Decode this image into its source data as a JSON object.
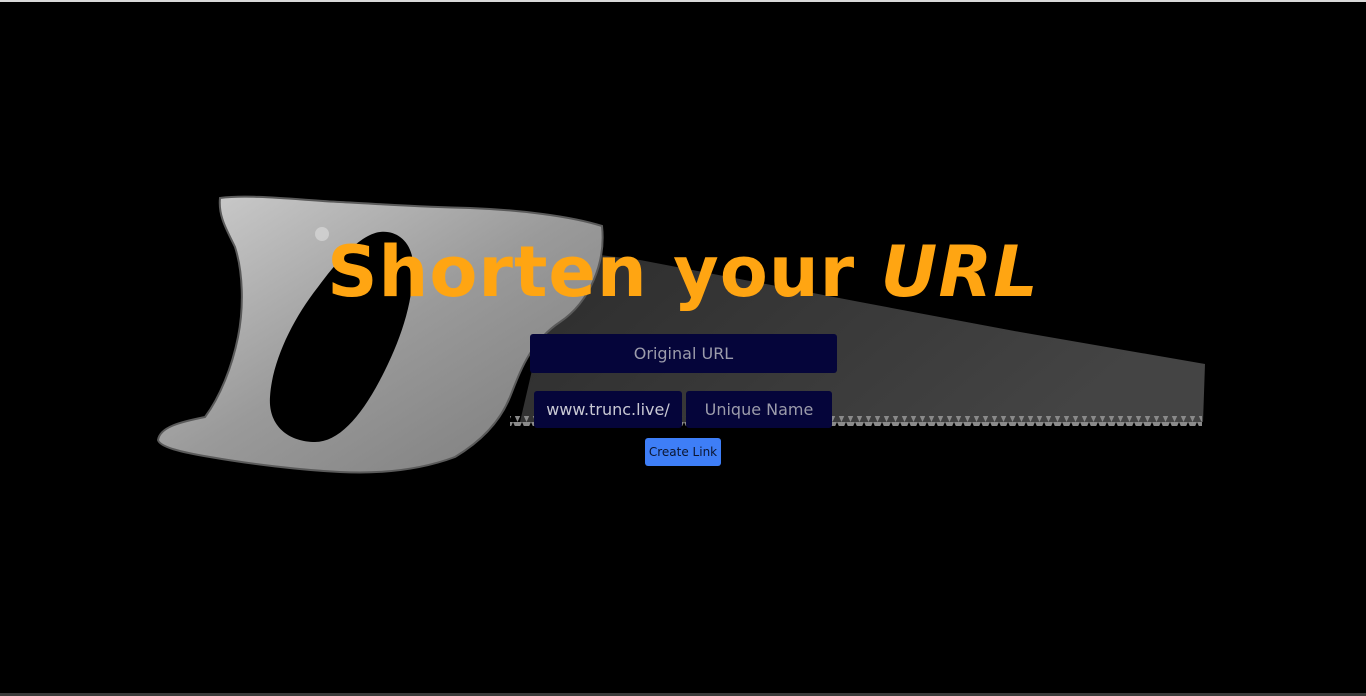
{
  "hero": {
    "title_main": "Shorten your ",
    "title_emphasis": "URL"
  },
  "form": {
    "original_url_placeholder": "Original URL",
    "prefix": "www.trunc.live/",
    "unique_name_placeholder": "Unique Name",
    "create_label": "Create Link"
  },
  "colors": {
    "title": "#ffa512",
    "input_bg": "#05053a",
    "button_bg": "#3e7ef7",
    "background": "#000000"
  },
  "background_image": {
    "icon": "hand-saw-image"
  }
}
